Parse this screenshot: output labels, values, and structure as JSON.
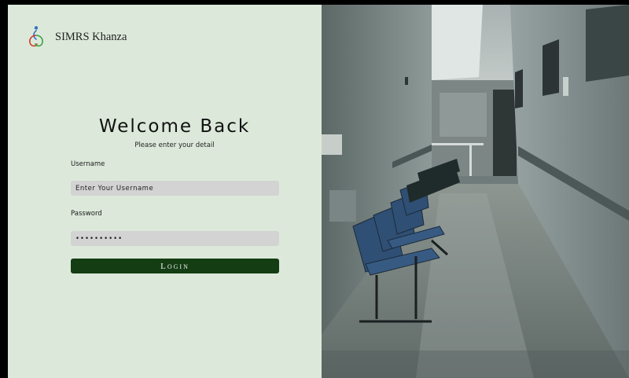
{
  "brand": {
    "name": "SIMRS Khanza",
    "logo_icon": "people-logo-icon",
    "logo_colors": [
      "#2f73c4",
      "#3aa043",
      "#d8342c"
    ]
  },
  "login": {
    "title": "Welcome Back",
    "subtitle": "Please enter your detail",
    "username_label": "Username",
    "username_placeholder": "Enter Your Username",
    "username_value": "",
    "password_label": "Password",
    "password_value": "••••••••••",
    "login_button": "Login"
  },
  "photo": {
    "subject": "hospital-corridor-image"
  },
  "colors": {
    "panel_background": "#dce9da",
    "input_background": "#d3d3d3",
    "button_background": "#143d14",
    "button_text": "#f2f2f2"
  }
}
